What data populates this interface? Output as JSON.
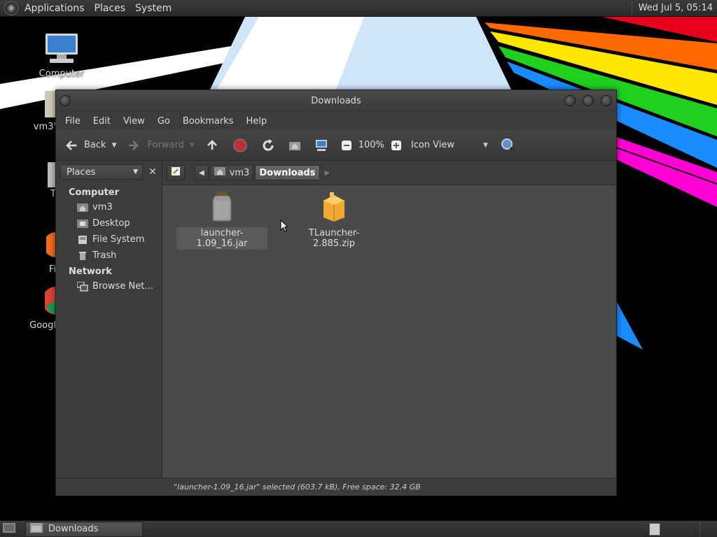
{
  "top_panel": {
    "menus": [
      "Applications",
      "Places",
      "System"
    ],
    "clock": "Wed Jul  5, 05:14"
  },
  "desktop_icons": [
    {
      "label": "Computer",
      "icon": "computer-icon"
    },
    {
      "label": "vm3'",
      "icon": "home-folder-icon"
    },
    {
      "label": "T",
      "icon": "trash-icon"
    },
    {
      "label": "Fi",
      "icon": "firefox-icon"
    },
    {
      "label": "Googl",
      "icon": "chrome-icon"
    }
  ],
  "window": {
    "title": "Downloads",
    "menubar": [
      "File",
      "Edit",
      "View",
      "Go",
      "Bookmarks",
      "Help"
    ],
    "toolbar": {
      "back": "Back",
      "forward": "Forward",
      "zoom": "100%",
      "view_mode": "Icon View"
    },
    "sidebar": {
      "selector": "Places",
      "sections": [
        {
          "title": "Computer",
          "items": [
            {
              "label": "vm3",
              "icon": "home-icon"
            },
            {
              "label": "Desktop",
              "icon": "desktop-icon"
            },
            {
              "label": "File System",
              "icon": "drive-icon"
            },
            {
              "label": "Trash",
              "icon": "trash-icon"
            }
          ]
        },
        {
          "title": "Network",
          "items": [
            {
              "label": "Browse Net…",
              "icon": "network-icon"
            }
          ]
        }
      ]
    },
    "pathbar": {
      "crumbs": [
        "vm3",
        "Downloads"
      ]
    },
    "files": [
      {
        "name": "launcher-1.09_16.jar",
        "icon": "jar-icon",
        "selected": true
      },
      {
        "name": "TLauncher-2.885.zip",
        "icon": "archive-icon",
        "selected": false
      }
    ],
    "status": "\"launcher-1.09_16.jar\" selected (603.7 kB), Free space: 32.4 GB"
  },
  "bottom_panel": {
    "task": "Downloads"
  },
  "colors": {
    "panel": "#2f2f2f",
    "window_bg": "#3c3c3c",
    "view_bg": "#4a4a4a",
    "folder_orange": "#f0a830"
  }
}
